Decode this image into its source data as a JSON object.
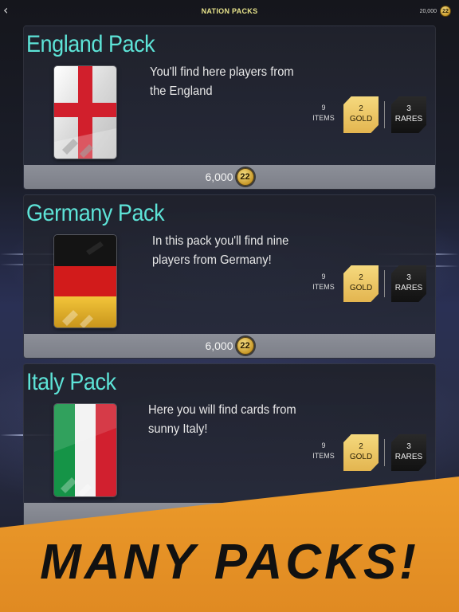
{
  "header": {
    "title": "NATION PACKS",
    "balance": "20,000",
    "coin_label": "22"
  },
  "packs": [
    {
      "title": "England Pack",
      "description": "You'll find here players from the England",
      "items_count": "9",
      "items_label": "ITEMS",
      "gold_count": "2",
      "gold_label": "GOLD",
      "rares_count": "3",
      "rares_label": "RARES",
      "price": "6,000",
      "price_coin_label": "22",
      "flag": "england"
    },
    {
      "title": "Germany Pack",
      "description": "In this pack you'll find nine players from Germany!",
      "items_count": "9",
      "items_label": "ITEMS",
      "gold_count": "2",
      "gold_label": "GOLD",
      "rares_count": "3",
      "rares_label": "RARES",
      "price": "6,000",
      "price_coin_label": "22",
      "flag": "germany"
    },
    {
      "title": "Italy Pack",
      "description": "Here you will find cards from sunny Italy!",
      "items_count": "9",
      "items_label": "ITEMS",
      "gold_count": "2",
      "gold_label": "GOLD",
      "rares_count": "3",
      "rares_label": "RARES",
      "flag": "italy"
    }
  ],
  "banner": {
    "text": "MANY PACKS!"
  },
  "colors": {
    "title": "#5de3d7",
    "gold": "#e9bf5c",
    "banner": "#e7962a",
    "header_title": "#e6e28a"
  },
  "icons": {
    "back": "chevron-left-icon",
    "coin": "coin-icon"
  }
}
